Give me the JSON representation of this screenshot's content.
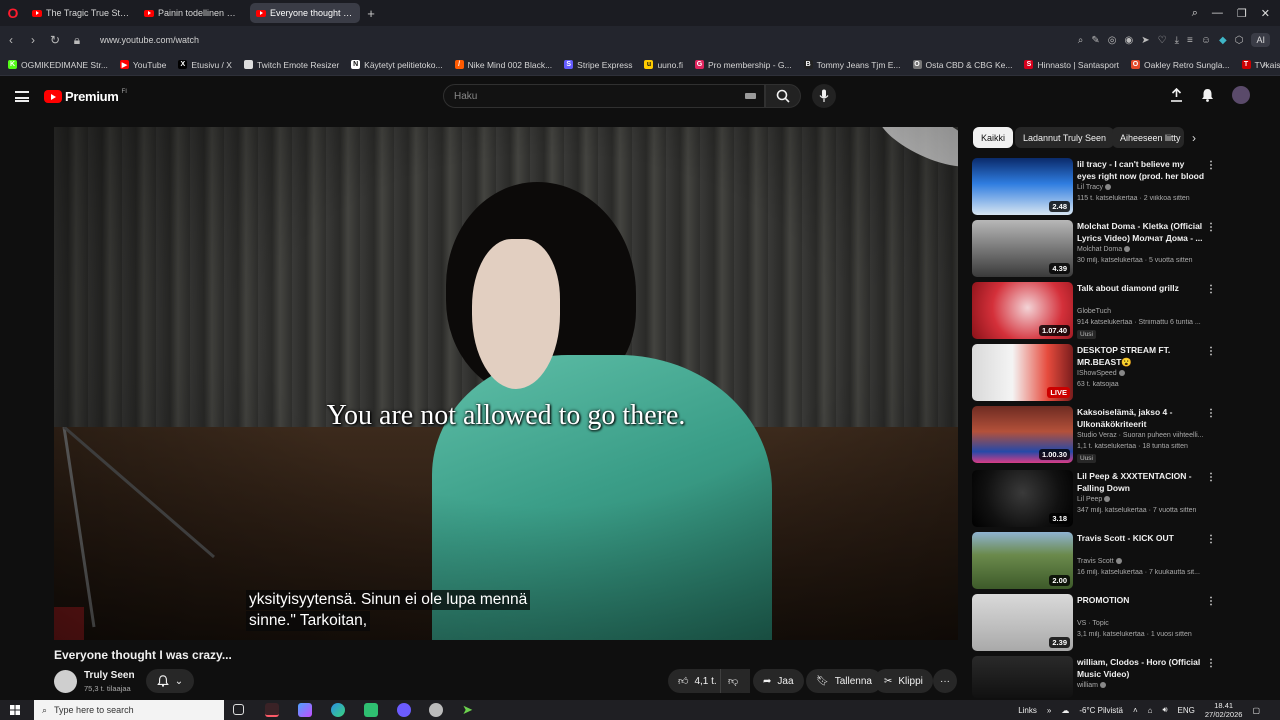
{
  "browser": {
    "tabs": [
      {
        "label": "The Tragic True Story of Ju",
        "active": false
      },
      {
        "label": "Painin todellinen merkitys",
        "active": false
      },
      {
        "label": "Everyone thought I wa",
        "active": true
      }
    ],
    "url": "www.youtube.com/watch",
    "ai_label": "AI",
    "bookmarks": [
      {
        "label": "OGMIKEDIMANE Str...",
        "color": "#53fc18",
        "icon": "K"
      },
      {
        "label": "YouTube",
        "color": "#ff0000",
        "icon": "▶"
      },
      {
        "label": "Etusivu / X",
        "color": "#000000",
        "icon": "X"
      },
      {
        "label": "Twitch Emote Resizer",
        "color": "#dddddd",
        "icon": ""
      },
      {
        "label": "Käytetyt pelitietoko...",
        "color": "#ffffff",
        "icon": "N"
      },
      {
        "label": "Nike Mind 002 Black...",
        "color": "#ff5a00",
        "icon": "/"
      },
      {
        "label": "Stripe Express",
        "color": "#635bff",
        "icon": "S"
      },
      {
        "label": "uuno.fi",
        "color": "#ffcc00",
        "icon": "u"
      },
      {
        "label": "Pro membership - G...",
        "color": "#e0245e",
        "icon": "G"
      },
      {
        "label": "Tommy Jeans Tjm E...",
        "color": "#222222",
        "icon": "B"
      },
      {
        "label": "Osta CBD & CBG Ke...",
        "color": "#777777",
        "icon": "O"
      },
      {
        "label": "Hinnasto | Santasport",
        "color": "#d6001c",
        "icon": "S"
      },
      {
        "label": "Oakley Retro Sungla...",
        "color": "#e34a2a",
        "icon": "O"
      },
      {
        "label": "TVkaista - Sub Suora",
        "color": "#cc0000",
        "icon": "T"
      }
    ]
  },
  "youtube": {
    "logo_text": "Premium",
    "logo_sup": "FI",
    "search_placeholder": "Haku",
    "video": {
      "caption": "You are not allowed to go there.",
      "subtitle_line1": "yksityisyytensä. Sinun ei ole lupa mennä",
      "subtitle_line2": "sinne.\" Tarkoitan,",
      "title": "Everyone thought I was crazy...",
      "channel": "Truly Seen",
      "subscribers": "75,3 t. tilaajaa",
      "likes": "4,1 t.",
      "share": "Jaa",
      "save": "Tallenna",
      "clip": "Klippi",
      "more": "···"
    },
    "chips": [
      {
        "label": "Kaikki",
        "active": true
      },
      {
        "label": "Ladannut Truly Seen",
        "active": false
      },
      {
        "label": "Aiheeseen liitty",
        "active": false
      }
    ],
    "recommendations": [
      {
        "title": "lil tracy - I can't believe my eyes right now (prod. her blood 🩸)",
        "channel": "Lil Tracy",
        "verified": true,
        "stats": "115 t. katselukertaa · 2 viikkoa sitten",
        "duration": "2.48",
        "badge": "",
        "live": false
      },
      {
        "title": "Molchat Doma - Kletka (Official Lyrics Video) Молчат Дома - ...",
        "channel": "Molchat Doma",
        "verified": true,
        "stats": "30 milj. katselukertaa · 5 vuotta sitten",
        "duration": "4.39",
        "badge": "",
        "live": false
      },
      {
        "title": "Talk about diamond grillz",
        "channel": "GlobeTuch",
        "verified": false,
        "stats": "914 katselukertaa · Striimattu 6 tuntia ...",
        "duration": "1.07.40",
        "badge": "Uusi",
        "live": false
      },
      {
        "title": "DESKTOP STREAM FT. MR.BEAST😮",
        "channel": "IShowSpeed",
        "verified": true,
        "stats": "63 t. katsojaa",
        "duration": "LIVE",
        "badge": "",
        "live": true
      },
      {
        "title": "Kaksoiselämä, jakso 4 - Ulkonäkökriteerit",
        "channel": "Studio Veraz · Suoran puheen viihteelli...",
        "verified": false,
        "stats": "1,1 t. katselukertaa · 18 tuntia sitten",
        "duration": "1.00.30",
        "badge": "Uusi",
        "live": false
      },
      {
        "title": "Lil Peep & XXXTENTACION - Falling Down",
        "channel": "Lil Peep",
        "verified": true,
        "stats": "347 milj. katselukertaa · 7 vuotta sitten",
        "duration": "3.18",
        "badge": "",
        "live": false
      },
      {
        "title": "Travis Scott - KICK OUT",
        "channel": "Travis Scott",
        "verified": true,
        "stats": "16 milj. katselukertaa · 7 kuukautta sit...",
        "duration": "2.00",
        "badge": "",
        "live": false
      },
      {
        "title": "PROMOTION",
        "channel": "VS · Topic",
        "verified": false,
        "stats": "3,1 milj. katselukertaa · 1 vuosi sitten",
        "duration": "2.39",
        "badge": "",
        "live": false
      },
      {
        "title": "william, Clodos - Horo (Official Music Video)",
        "channel": "william",
        "verified": true,
        "stats": "",
        "duration": "",
        "badge": "",
        "live": false
      }
    ]
  },
  "taskbar": {
    "search_placeholder": "Type here to search",
    "links_label": "Links",
    "weather": "-6°C  Pilvistä",
    "language": "ENG",
    "time": "18.41",
    "date": "27/02/2026"
  }
}
